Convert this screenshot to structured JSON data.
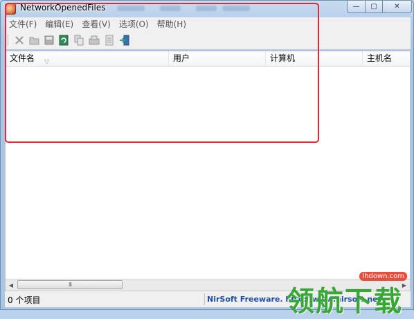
{
  "window": {
    "title": "NetworkOpenedFiles",
    "controls": {
      "minimize_glyph": "—",
      "maximize_glyph": "▢",
      "close_glyph": "✕"
    }
  },
  "menu": {
    "items": [
      "文件(F)",
      "编辑(E)",
      "查看(V)",
      "选项(O)",
      "帮助(H)"
    ]
  },
  "toolbar": {
    "icons": [
      "delete-icon",
      "open-icon",
      "save-icon",
      "refresh-icon",
      "copy-icon",
      "properties-icon",
      "html-report-icon",
      "exit-icon"
    ]
  },
  "list": {
    "columns": [
      "文件名",
      "用户",
      "计算机",
      "主机名"
    ],
    "sort_indicator": "▽",
    "rows": []
  },
  "scrollbar": {
    "left_glyph": "◀",
    "right_glyph": "▶",
    "thumb_grip": "III"
  },
  "status": {
    "item_count": "0 个项目",
    "credit": "NirSoft Freeware.  http://www.nirsoft.net"
  },
  "watermark": {
    "url": "lhdown.com",
    "text": "领航下载"
  },
  "colors": {
    "highlight": "#e1283a",
    "link": "#1f4fa8",
    "watermark_green": "#39a638"
  }
}
